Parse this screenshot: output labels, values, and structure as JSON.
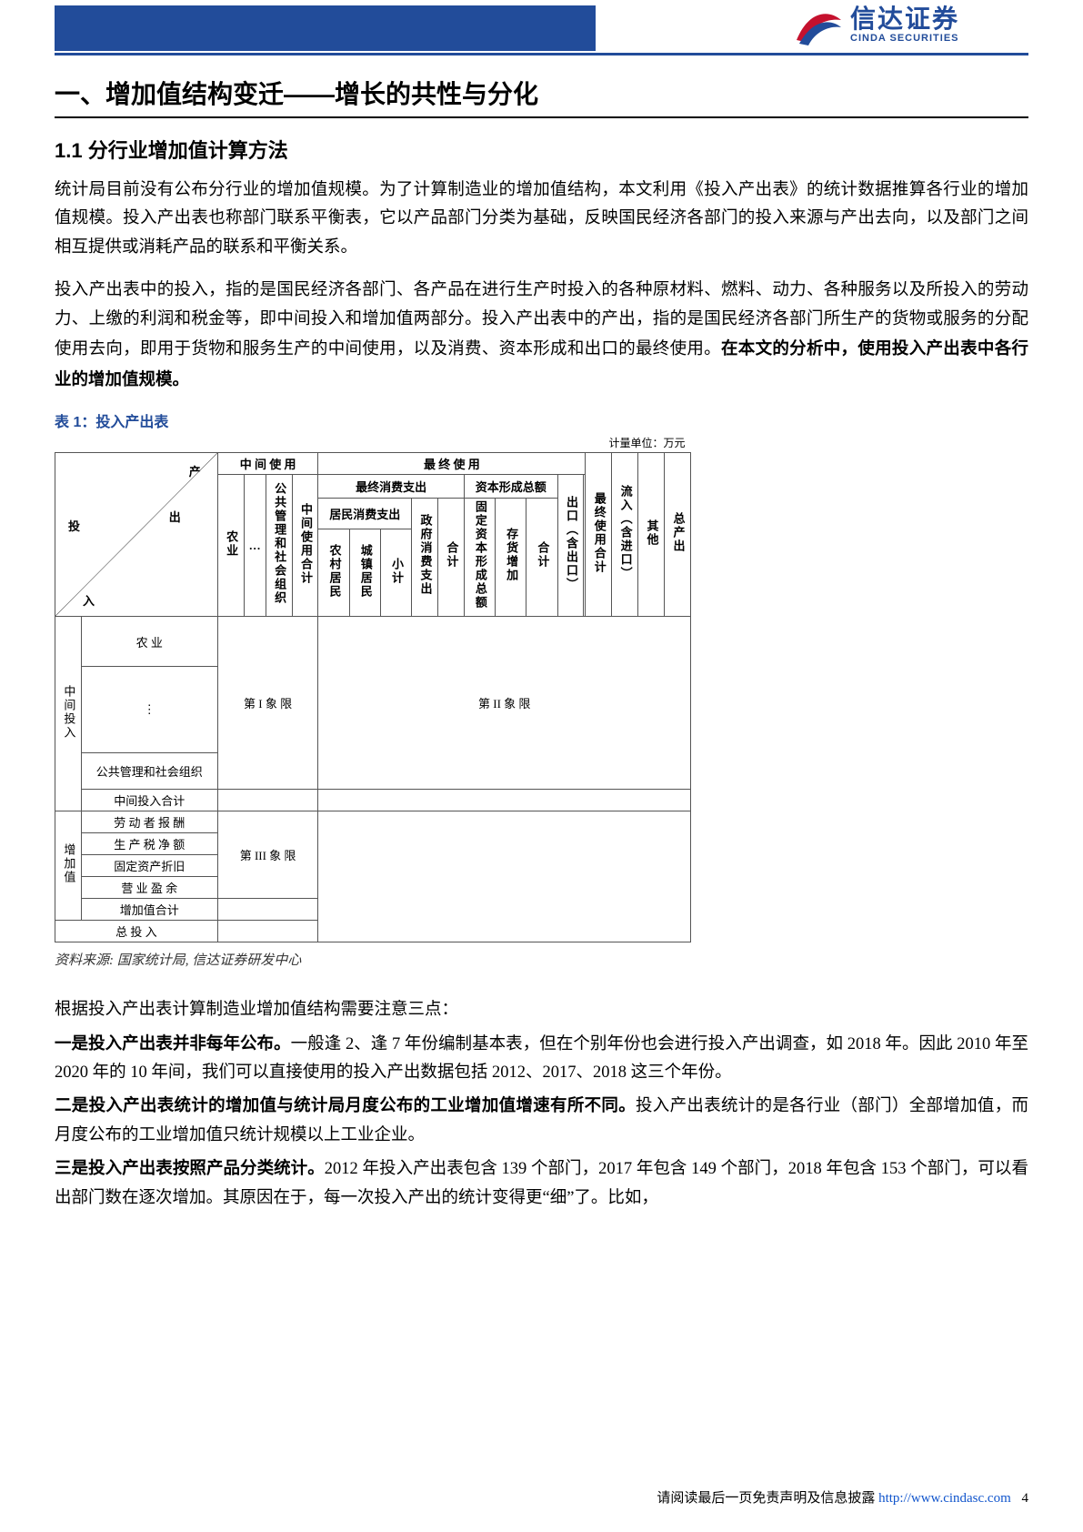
{
  "logo": {
    "cn": "信达证券",
    "en": "CINDA SECURITIES"
  },
  "h1": "一、增加值结构变迁——增长的共性与分化",
  "h2": "1.1 分行业增加值计算方法",
  "p1": "统计局目前没有公布分行业的增加值规模。为了计算制造业的增加值结构，本文利用《投入产出表》的统计数据推算各行业的增加值规模。投入产出表也称部门联系平衡表，它以产品部门分类为基础，反映国民经济各部门的投入来源与产出去向，以及部门之间相互提供或消耗产品的联系和平衡关系。",
  "p2a": "投入产出表中的投入，指的是国民经济各部门、各产品在进行生产时投入的各种原材料、燃料、动力、各种服务以及所投入的劳动力、上缴的利润和税金等，即中间投入和增加值两部分。投入产出表中的产出，指的是国民经济各部门所生产的货物或服务的分配使用去向，即用于货物和服务生产的中间使用，以及消费、资本形成和出口的最终使用。",
  "p2b": "在本文的分析中，使用投入产出表中各行业的增加值规模。",
  "table_caption": "表 1：投入产出表",
  "table": {
    "unit": "计量单位：万元",
    "diag": {
      "output": "产",
      "out": "出",
      "input": "投",
      "in": "入"
    },
    "top": {
      "mid_use": "中 间 使 用",
      "final_use": "最 终 使 用",
      "agric": "农业",
      "etc": "…",
      "pub_org": "公共管理和社会组织",
      "mid_total": "中间使用合计",
      "fce": "最终消费支出",
      "hce": "居民消费支出",
      "rural": "农村居民",
      "urban": "城镇居民",
      "sub": "小计",
      "gov": "政府消费支出",
      "fce_total": "合计",
      "gcf": "资本形成总额",
      "fcf": "固定资本形成总额",
      "inv": "存货增加",
      "gcf_total": "合计",
      "export": "出口（含出口）",
      "final_total": "最终使用合计",
      "import": "流入（含进口）",
      "other": "其他",
      "gross_out": "总产出"
    },
    "rows": {
      "mid_input_label": "中间投入",
      "agric": "农 业",
      "dots": "⋮",
      "pub_org": "公共管理和社会组织",
      "mid_total": "中间投入合计",
      "va_label": "增加值",
      "comp": "劳 动 者 报 酬",
      "tax": "生 产 税 净 额",
      "dep": "固定资产折旧",
      "surplus": "营 业 盈 余",
      "va_total": "增加值合计",
      "gross_in": "总 投 入",
      "q1": "第 I 象 限",
      "q2": "第 II 象 限",
      "q3": "第 III 象 限"
    }
  },
  "source": "资料来源: 国家统计局, 信达证券研发中心",
  "p3": "根据投入产出表计算制造业增加值结构需要注意三点：",
  "p4a_bold": "一是投入产出表并非每年公布。",
  "p4a": "一般逢 2、逢 7 年份编制基本表，但在个别年份也会进行投入产出调查，如 2018 年。因此 2010 年至 2020 年的 10 年间，我们可以直接使用的投入产出数据包括 2012、2017、2018 这三个年份。",
  "p4b_bold": "二是投入产出表统计的增加值与统计局月度公布的工业增加值增速有所不同。",
  "p4b": "投入产出表统计的是各行业（部门）全部增加值，而月度公布的工业增加值只统计规模以上工业企业。",
  "p4c_bold": "三是投入产出表按照产品分类统计。",
  "p4c": "2012 年投入产出表包含 139 个部门，2017 年包含 149 个部门，2018 年包含 153 个部门，可以看出部门数在逐次增加。其原因在于，每一次投入产出的统计变得更“细”了。比如，",
  "footer": {
    "text": "请阅读最后一页免责声明及信息披露",
    "url_label": "http://www.cindasc.com",
    "page": "4"
  }
}
